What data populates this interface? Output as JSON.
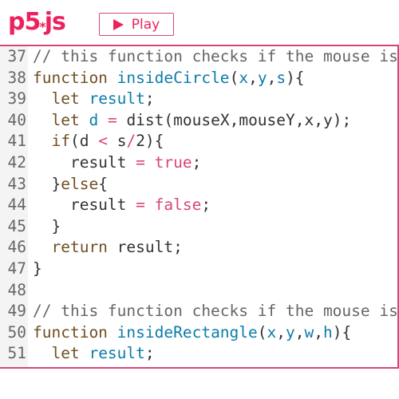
{
  "header": {
    "logo_text": "p5",
    "logo_mark": "*",
    "logo_suffix": "js",
    "play_label": "Play"
  },
  "colors": {
    "accent": "#ed225d",
    "comment": "#666666",
    "keyword": "#704f21",
    "definition": "#0b7ca9",
    "operator": "#d9457a",
    "text": "#333333"
  },
  "editor": {
    "lines": [
      {
        "num": "37",
        "tokens": [
          [
            "comment",
            "// this function checks if the mouse is"
          ]
        ]
      },
      {
        "num": "38",
        "tokens": [
          [
            "keyword",
            "function "
          ],
          [
            "def",
            "insideCircle"
          ],
          [
            "plain",
            "("
          ],
          [
            "var",
            "x"
          ],
          [
            "plain",
            ","
          ],
          [
            "var",
            "y"
          ],
          [
            "plain",
            ","
          ],
          [
            "var",
            "s"
          ],
          [
            "plain",
            "){"
          ]
        ]
      },
      {
        "num": "39",
        "tokens": [
          [
            "plain",
            "  "
          ],
          [
            "keyword",
            "let "
          ],
          [
            "var",
            "result"
          ],
          [
            "plain",
            ";"
          ]
        ]
      },
      {
        "num": "40",
        "tokens": [
          [
            "plain",
            "  "
          ],
          [
            "keyword",
            "let "
          ],
          [
            "var",
            "d"
          ],
          [
            "plain",
            " "
          ],
          [
            "op",
            "="
          ],
          [
            "plain",
            " dist(mouseX,mouseY,x,y);"
          ]
        ]
      },
      {
        "num": "41",
        "tokens": [
          [
            "plain",
            "  "
          ],
          [
            "keyword",
            "if"
          ],
          [
            "plain",
            "(d "
          ],
          [
            "op",
            "<"
          ],
          [
            "plain",
            " s"
          ],
          [
            "op",
            "/"
          ],
          [
            "plain",
            "2){"
          ]
        ]
      },
      {
        "num": "42",
        "tokens": [
          [
            "plain",
            "    result "
          ],
          [
            "op",
            "="
          ],
          [
            "plain",
            " "
          ],
          [
            "bool",
            "true"
          ],
          [
            "plain",
            ";"
          ]
        ]
      },
      {
        "num": "43",
        "tokens": [
          [
            "plain",
            "  }"
          ],
          [
            "keyword",
            "else"
          ],
          [
            "plain",
            "{"
          ]
        ]
      },
      {
        "num": "44",
        "tokens": [
          [
            "plain",
            "    result "
          ],
          [
            "op",
            "="
          ],
          [
            "plain",
            " "
          ],
          [
            "bool",
            "false"
          ],
          [
            "plain",
            ";"
          ]
        ]
      },
      {
        "num": "45",
        "tokens": [
          [
            "plain",
            "  }"
          ]
        ]
      },
      {
        "num": "46",
        "tokens": [
          [
            "plain",
            "  "
          ],
          [
            "keyword",
            "return "
          ],
          [
            "plain",
            "result;"
          ]
        ]
      },
      {
        "num": "47",
        "tokens": [
          [
            "plain",
            "}"
          ]
        ]
      },
      {
        "num": "48",
        "tokens": []
      },
      {
        "num": "49",
        "tokens": [
          [
            "comment",
            "// this function checks if the mouse is"
          ]
        ]
      },
      {
        "num": "50",
        "tokens": [
          [
            "keyword",
            "function "
          ],
          [
            "def",
            "insideRectangle"
          ],
          [
            "plain",
            "("
          ],
          [
            "var",
            "x"
          ],
          [
            "plain",
            ","
          ],
          [
            "var",
            "y"
          ],
          [
            "plain",
            ","
          ],
          [
            "var",
            "w"
          ],
          [
            "plain",
            ","
          ],
          [
            "var",
            "h"
          ],
          [
            "plain",
            "){"
          ]
        ]
      },
      {
        "num": "51",
        "tokens": [
          [
            "plain",
            "  "
          ],
          [
            "keyword",
            "let "
          ],
          [
            "var",
            "result"
          ],
          [
            "plain",
            ";"
          ]
        ]
      }
    ]
  }
}
